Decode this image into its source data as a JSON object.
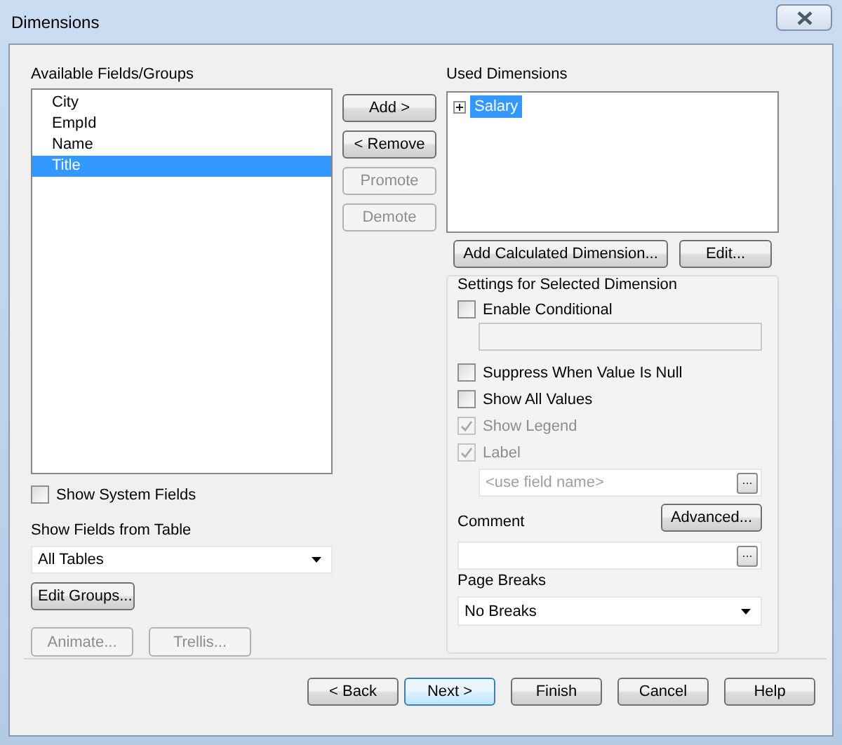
{
  "window": {
    "title": "Dimensions"
  },
  "available": {
    "label": "Available Fields/Groups",
    "items": [
      {
        "label": "City",
        "selected": false
      },
      {
        "label": "EmpId",
        "selected": false
      },
      {
        "label": "Name",
        "selected": false
      },
      {
        "label": "Title",
        "selected": true
      }
    ]
  },
  "move_buttons": [
    {
      "label": "Add >",
      "disabled": false
    },
    {
      "label": "< Remove",
      "disabled": false
    },
    {
      "label": "Promote",
      "disabled": true
    },
    {
      "label": "Demote",
      "disabled": true
    }
  ],
  "show_system_fields": {
    "label": "Show System Fields",
    "checked": false
  },
  "table_filter": {
    "label": "Show Fields from Table",
    "value": "All Tables"
  },
  "edit_groups": {
    "label": "Edit Groups...",
    "disabled": false
  },
  "extra_buttons": [
    {
      "label": "Animate...",
      "disabled": true
    },
    {
      "label": "Trellis...",
      "disabled": true
    }
  ],
  "used": {
    "label": "Used Dimensions",
    "items": [
      {
        "label": "Salary",
        "selected": true,
        "expanded": false
      }
    ]
  },
  "used_buttons": [
    {
      "label": "Add Calculated Dimension...",
      "disabled": false
    },
    {
      "label": "Edit...",
      "disabled": false
    }
  ],
  "settings": {
    "title": "Settings for Selected Dimension",
    "rows": [
      {
        "kind": "checkbox",
        "label": "Enable Conditional",
        "checked": false,
        "disabled": false
      },
      {
        "kind": "field",
        "disabled": true
      },
      {
        "kind": "checkbox",
        "label": "Suppress When Value Is Null",
        "checked": false,
        "disabled": false
      },
      {
        "kind": "checkbox",
        "label": "Show All Values",
        "checked": false,
        "disabled": false
      },
      {
        "kind": "checkbox",
        "label": "Show Legend",
        "checked": true,
        "disabled": true
      },
      {
        "kind": "checkbox",
        "label": "Label",
        "checked": true,
        "disabled": true
      },
      {
        "kind": "field_button",
        "placeholder": "<use field name>",
        "button_label": "..."
      }
    ],
    "advanced": {
      "label": "Advanced...",
      "disabled": false
    },
    "comment": {
      "label": "Comment",
      "button_label": "..."
    },
    "page_breaks": {
      "label": "Page Breaks",
      "value": "No Breaks"
    }
  },
  "footer_buttons": [
    {
      "label": "< Back",
      "disabled": false,
      "hot": false
    },
    {
      "label": "Next >",
      "disabled": false,
      "hot": true
    },
    {
      "label": "Finish",
      "disabled": false,
      "hot": false
    },
    {
      "label": "Cancel",
      "disabled": false,
      "hot": false
    },
    {
      "label": "Help",
      "disabled": false,
      "hot": false
    }
  ]
}
